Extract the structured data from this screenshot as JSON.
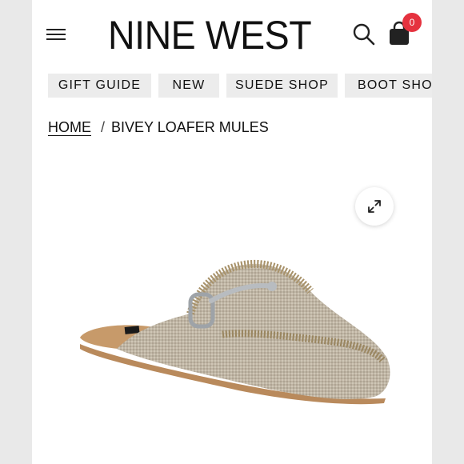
{
  "brand": {
    "logo": "NINE WEST"
  },
  "header": {
    "menu_icon": "hamburger-menu-icon",
    "search_icon": "search-icon",
    "bag_icon": "shopping-bag-icon",
    "bag_count": "0"
  },
  "nav": {
    "items": [
      "GIFT GUIDE",
      "NEW",
      "SUEDE SHOP",
      "BOOT SHOP"
    ]
  },
  "breadcrumb": {
    "home": "HOME",
    "separator": "/",
    "current": "BIVEY LOAFER MULES"
  },
  "gallery": {
    "zoom_icon": "expand-icon"
  },
  "colors": {
    "badge": "#e5323f",
    "nav_pill": "#ececec",
    "text": "#111111"
  }
}
